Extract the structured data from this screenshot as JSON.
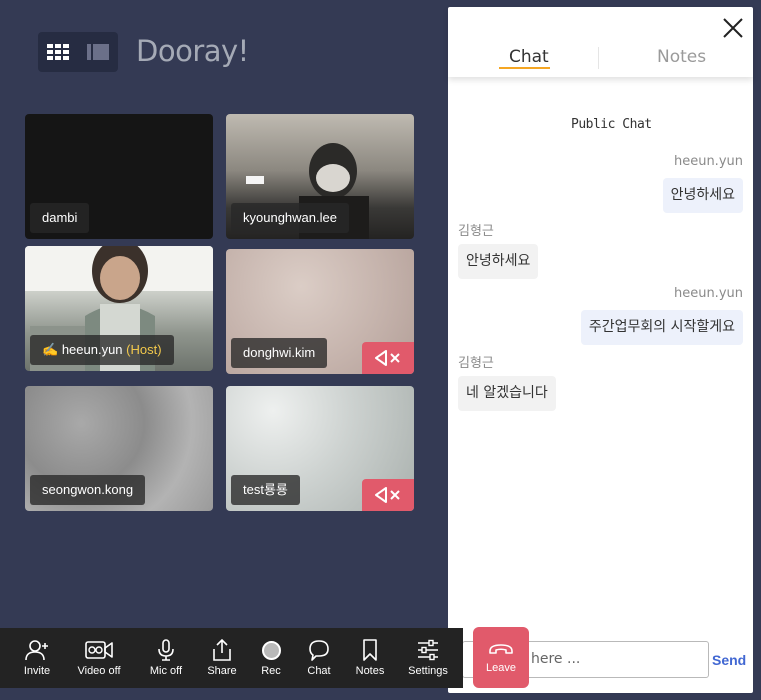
{
  "header": {
    "logo": "Dooray!"
  },
  "tiles": [
    {
      "name": "dambi",
      "muted": false
    },
    {
      "name": "kyounghwan.lee",
      "muted": false
    },
    {
      "name": "heeun.yun",
      "role": "(Host)",
      "muted": false
    },
    {
      "name": "donghwi.kim",
      "muted": true
    },
    {
      "name": "seongwon.kong",
      "muted": false
    },
    {
      "name": "test룡룡",
      "muted": true
    }
  ],
  "chat_panel": {
    "tabs": [
      {
        "label": "Chat",
        "active": true
      },
      {
        "label": "Notes",
        "active": false
      }
    ],
    "section_title": "Public Chat",
    "messages": [
      {
        "sender": "heeun.yun",
        "text": "안녕하세요",
        "direction": "out"
      },
      {
        "sender": "김형근",
        "text": "안녕하세요",
        "direction": "in"
      },
      {
        "sender": "heeun.yun",
        "text": "주간업무회의 시작할게요",
        "direction": "out"
      },
      {
        "sender": "김형근",
        "text": "네 알겠습니다",
        "direction": "in"
      }
    ],
    "input_placeholder": "here ...",
    "send_label": "Send"
  },
  "toolbar": {
    "invite": "Invite",
    "video_off": "Video off",
    "mic_off": "Mic off",
    "share": "Share",
    "rec": "Rec",
    "chat": "Chat",
    "notes": "Notes",
    "settings": "Settings",
    "leave": "Leave"
  },
  "colors": {
    "background": "#343a54",
    "accent": "#f5a623",
    "leave": "#e15a6b",
    "send": "#4167d2",
    "mute": "#e15a6b"
  }
}
